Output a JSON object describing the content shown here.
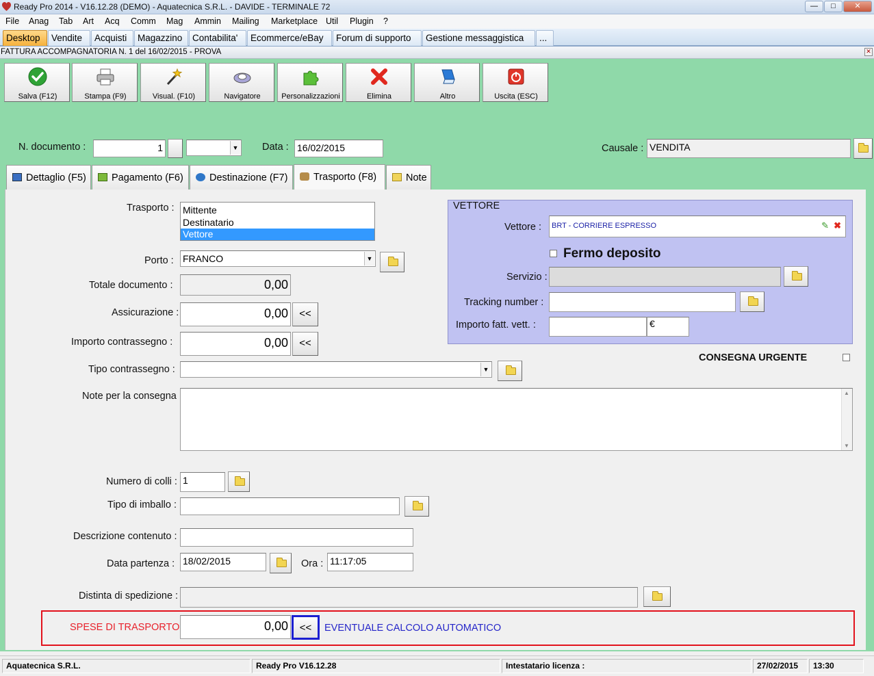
{
  "window": {
    "title": "Ready Pro 2014 - V16.12.28 (DEMO)  - Aquatecnica S.R.L. - DAVIDE - TERMINALE 72"
  },
  "menu": [
    "File",
    "Anag",
    "Tab",
    "Art",
    "Acq",
    "Comm",
    "Mag",
    "Ammin",
    "Mailing",
    "Marketplace",
    "Util",
    "Plugin",
    "?"
  ],
  "top_tabs": [
    "Desktop",
    "Vendite",
    "Acquisti",
    "Magazzino",
    "Contabilita'",
    "Ecommerce/eBay",
    "Forum di supporto",
    "Gestione messaggistica",
    "..."
  ],
  "form_title": "FATTURA ACCOMPAGNATORIA N. 1 del 16/02/2015 - PROVA",
  "toolbar": [
    {
      "label": "Salva (F12)",
      "icon": "check-icon"
    },
    {
      "label": "Stampa (F9)",
      "icon": "printer-icon"
    },
    {
      "label": "Visual. (F10)",
      "icon": "magic-wand-icon"
    },
    {
      "label": "Navigatore",
      "icon": "navigator-icon"
    },
    {
      "label": "Personalizzazioni",
      "icon": "puzzle-icon"
    },
    {
      "label": "Elimina",
      "icon": "delete-x-icon"
    },
    {
      "label": "Altro",
      "icon": "book-icon"
    },
    {
      "label": "Uscita (ESC)",
      "icon": "exit-icon"
    }
  ],
  "header": {
    "doc_label": "N. documento :",
    "doc_number": "1",
    "date_label": "Data :",
    "date_value": "16/02/2015",
    "causale_label": "Causale :",
    "causale_value": "VENDITA"
  },
  "sub_tabs": [
    "Dettaglio (F5)",
    "Pagamento (F6)",
    "Destinazione (F7)",
    "Trasporto (F8)",
    "Note"
  ],
  "transport": {
    "trasporto_label": "Trasporto :",
    "trasporto_options": [
      "Mittente",
      "Destinatario",
      "Vettore"
    ],
    "trasporto_selected": "Vettore",
    "porto_label": "Porto :",
    "porto_value": "FRANCO",
    "totale_label": "Totale documento :",
    "totale_value": "0,00",
    "assicurazione_label": "Assicurazione :",
    "assicurazione_value": "0,00",
    "contrassegno_label": "Importo contrassegno :",
    "contrassegno_value": "0,00",
    "tipo_contrassegno_label": "Tipo contrassegno :",
    "tipo_contrassegno_value": "",
    "note_label": "Note per la consegna",
    "note_value": "",
    "colli_label": "Numero di colli :",
    "colli_value": "1",
    "imballo_label": "Tipo di imballo :",
    "imballo_value": "",
    "descrizione_label": "Descrizione contenuto :",
    "descrizione_value": "",
    "partenza_label": "Data partenza :",
    "partenza_value": "18/02/2015",
    "ora_label": "Ora :",
    "ora_value": "11:17:05",
    "distinta_label": "Distinta di spedizione :",
    "distinta_value": "",
    "spese_label": "SPESE DI TRASPORTO",
    "spese_value": "0,00",
    "calcolo_label": "EVENTUALE CALCOLO AUTOMATICO",
    "arrow_label": "<<"
  },
  "vettore": {
    "group_title": "VETTORE",
    "vettore_label": "Vettore :",
    "vettore_value": "BRT - CORRIERE ESPRESSO",
    "fermo_label": "Fermo deposito",
    "servizio_label": "Servizio :",
    "tracking_label": "Tracking number :",
    "importo_label": "Importo fatt. vett. :",
    "currency": "€"
  },
  "consegna_urgente_label": "CONSEGNA URGENTE",
  "status": [
    "Aquatecnica S.R.L.",
    "Ready Pro V16.12.28",
    "Intestatario licenza :",
    "27/02/2015",
    "13:30"
  ]
}
